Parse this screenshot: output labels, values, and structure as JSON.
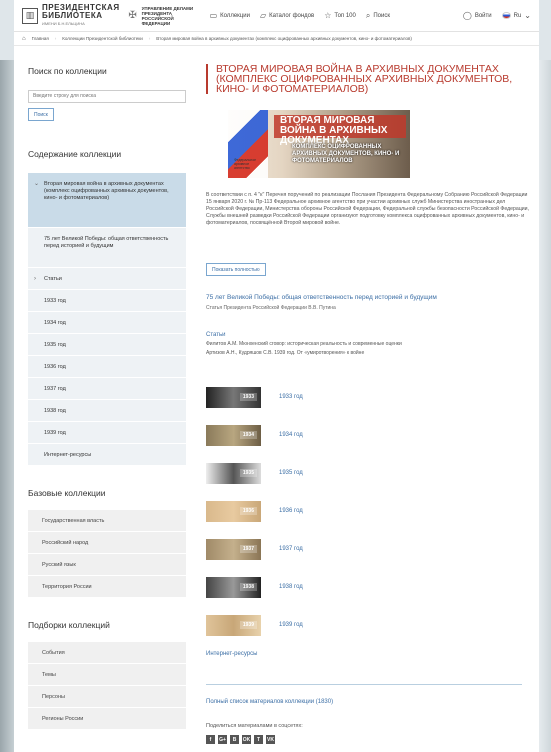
{
  "header": {
    "logo_line1": "ПРЕЗИДЕНТСКАЯ",
    "logo_line2": "БИБЛИОТЕКА",
    "logo_line3": "ИМЕНИ Б.Н.ЕЛЬЦИНА",
    "admin_text": "УПРАВЛЕНИЕ ДЕЛАМИ ПРЕЗИДЕНТА РОССИЙСКОЙ ФЕДЕРАЦИИ",
    "nav": [
      {
        "label": "Коллекции",
        "icon": "book-icon"
      },
      {
        "label": "Каталог фондов",
        "icon": "folder-icon"
      },
      {
        "label": "Топ 100",
        "icon": "star-icon"
      },
      {
        "label": "Поиск",
        "icon": "search-icon"
      }
    ],
    "login": "Войти",
    "lang": "Ru"
  },
  "breadcrumb": {
    "home": "Главная",
    "level2": "Коллекции Президентской библиотеки",
    "level3": "Вторая мировая война в архивных документах (комплекс оцифрованных архивных документов, кино- и фотоматериалов)"
  },
  "sidebar": {
    "search_title": "Поиск по коллекции",
    "search_placeholder": "Введите строку для поиска",
    "search_button": "Поиск",
    "toc_title": "Содержание коллекции",
    "toc": [
      "Вторая мировая война в архивных документах (комплекс оцифрованных архивных документов, кино- и фотоматериалов)",
      "75 лет Великой Победы: общая ответственность перед историей и будущим",
      "Статьи",
      "1933 год",
      "1934 год",
      "1935 год",
      "1936 год",
      "1937 год",
      "1938 год",
      "1939 год",
      "Интернет-ресурсы"
    ],
    "base_title": "Базовые коллекции",
    "base": [
      "Государственная власть",
      "Российский народ",
      "Русский язык",
      "Территория России"
    ],
    "sel_title": "Подборки коллекций",
    "sel": [
      "События",
      "Темы",
      "Персоны",
      "Регионы России"
    ]
  },
  "main": {
    "title": "Вторая мировая война в архивных документах (комплекс оцифрованных архивных документов, кино- и фотоматериалов)",
    "banner_title": "Вторая мировая война в архивных документах",
    "banner_sub": "Комплекс оцифрованных архивных документов, кино- и фотоматериалов",
    "banner_small": "Федеральное архивное агентство",
    "paragraph": "В соответствии с п. 4 \"к\" Перечня поручений по реализации Послания Президента Федеральному Собранию Российской Федерации 15 января 2020 г. № Пр-113 Федеральное архивное агентство при участии архивных служб Министерства иностранных дел Российской Федерации, Министерства обороны Российской Федерации, Федеральной службы безопасности Российской Федерации, Службы внешней разведки Российской Федерации организуют подготовку комплекса оцифрованных архивных документов, кино- и фотоматериалов, посвящённой Второй мировой войне.",
    "more_button": "Показать полностью",
    "victory_link": "75 лет Великой Победы: общая ответственность перед историей и будущим",
    "victory_sub": "Статья Президента Российской Федерации В.В. Путина",
    "articles_head": "Статьи",
    "articles": [
      "Филитов А.М. Мюнхенский сговор: историческая реальность и современные оценки",
      "Артизов А.Н., Кудряшов С.В. 1939 год. От «умиротворения» к войне"
    ],
    "years": [
      "1933 год",
      "1934 год",
      "1935 год",
      "1936 год",
      "1937 год",
      "1938 год",
      "1939 год"
    ],
    "year_badges": [
      "1933",
      "1934",
      "1935",
      "1936",
      "1937",
      "1938",
      "1939"
    ],
    "internet": "Интернет-ресурсы",
    "full_list": "Полный список материалов коллекции (1830)",
    "share": "Поделиться материалами в соцсетях:",
    "social": [
      "f",
      "G+",
      "B",
      "OK",
      "T",
      "VK"
    ]
  }
}
